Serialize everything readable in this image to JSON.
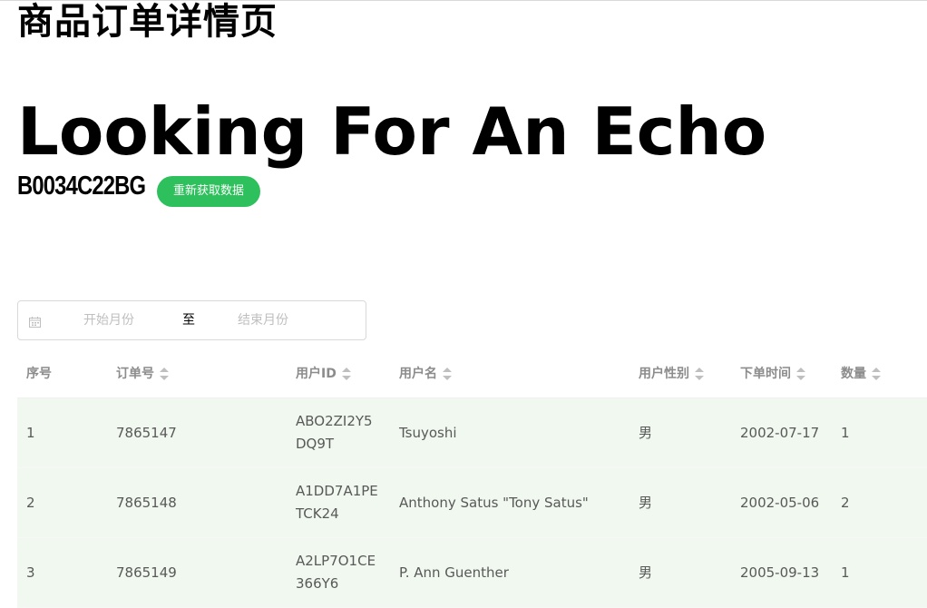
{
  "page": {
    "title": "商品订单详情页",
    "product_name": "Looking For An Echo",
    "asin": "B0034C22BG",
    "refresh_button": "重新获取数据"
  },
  "date_range": {
    "start_placeholder": "开始月份",
    "separator": "至",
    "end_placeholder": "结束月份"
  },
  "table": {
    "columns": [
      "序号",
      "订单号",
      "用户ID",
      "用户名",
      "用户性别",
      "下单时间",
      "数量"
    ],
    "rows": [
      [
        "1",
        "7865147",
        "ABO2ZI2Y5DQ9T",
        "Tsuyoshi",
        "男",
        "2002-07-17",
        "1"
      ],
      [
        "2",
        "7865148",
        "A1DD7A1PETCK24",
        "Anthony Satus \"Tony Satus\"",
        "男",
        "2002-05-06",
        "2"
      ],
      [
        "3",
        "7865149",
        "A2LP7O1CE366Y6",
        "P. Ann Guenther",
        "男",
        "2005-09-13",
        "1"
      ]
    ]
  },
  "colors": {
    "accent": "#2ec05c",
    "row_background": "#f0f8ef"
  }
}
